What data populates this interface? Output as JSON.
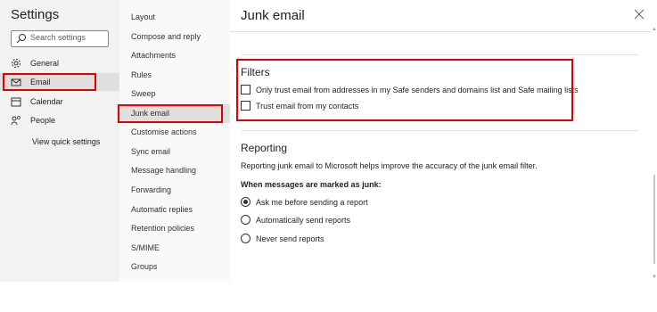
{
  "settings_panel": {
    "title": "Settings",
    "search": {
      "placeholder": "Search settings"
    },
    "nav": [
      {
        "label": "General",
        "icon": "gear-icon"
      },
      {
        "label": "Email",
        "icon": "mail-icon"
      },
      {
        "label": "Calendar",
        "icon": "calendar-icon"
      },
      {
        "label": "People",
        "icon": "people-icon"
      }
    ],
    "quick_settings_label": "View quick settings"
  },
  "email_submenu": {
    "items": [
      "Layout",
      "Compose and reply",
      "Attachments",
      "Rules",
      "Sweep",
      "Junk email",
      "Customise actions",
      "Sync email",
      "Message handling",
      "Forwarding",
      "Automatic replies",
      "Retention policies",
      "S/MIME",
      "Groups"
    ],
    "selected_index": 5
  },
  "junk_email": {
    "title": "Junk email",
    "filters": {
      "heading": "Filters",
      "options": [
        {
          "label": "Only trust email from addresses in my Safe senders and domains list and Safe mailing lists",
          "checked": false
        },
        {
          "label": "Trust email from my contacts",
          "checked": false
        }
      ]
    },
    "reporting": {
      "heading": "Reporting",
      "description": "Reporting junk email to Microsoft helps improve the accuracy of the junk email filter.",
      "question": "When messages are marked as junk:",
      "options": [
        {
          "label": "Ask me before sending a report",
          "selected": true
        },
        {
          "label": "Automatically send reports",
          "selected": false
        },
        {
          "label": "Never send reports",
          "selected": false
        }
      ]
    }
  },
  "colors": {
    "highlight_box": "#e00000",
    "selected_bg": "#e1dfdd"
  }
}
